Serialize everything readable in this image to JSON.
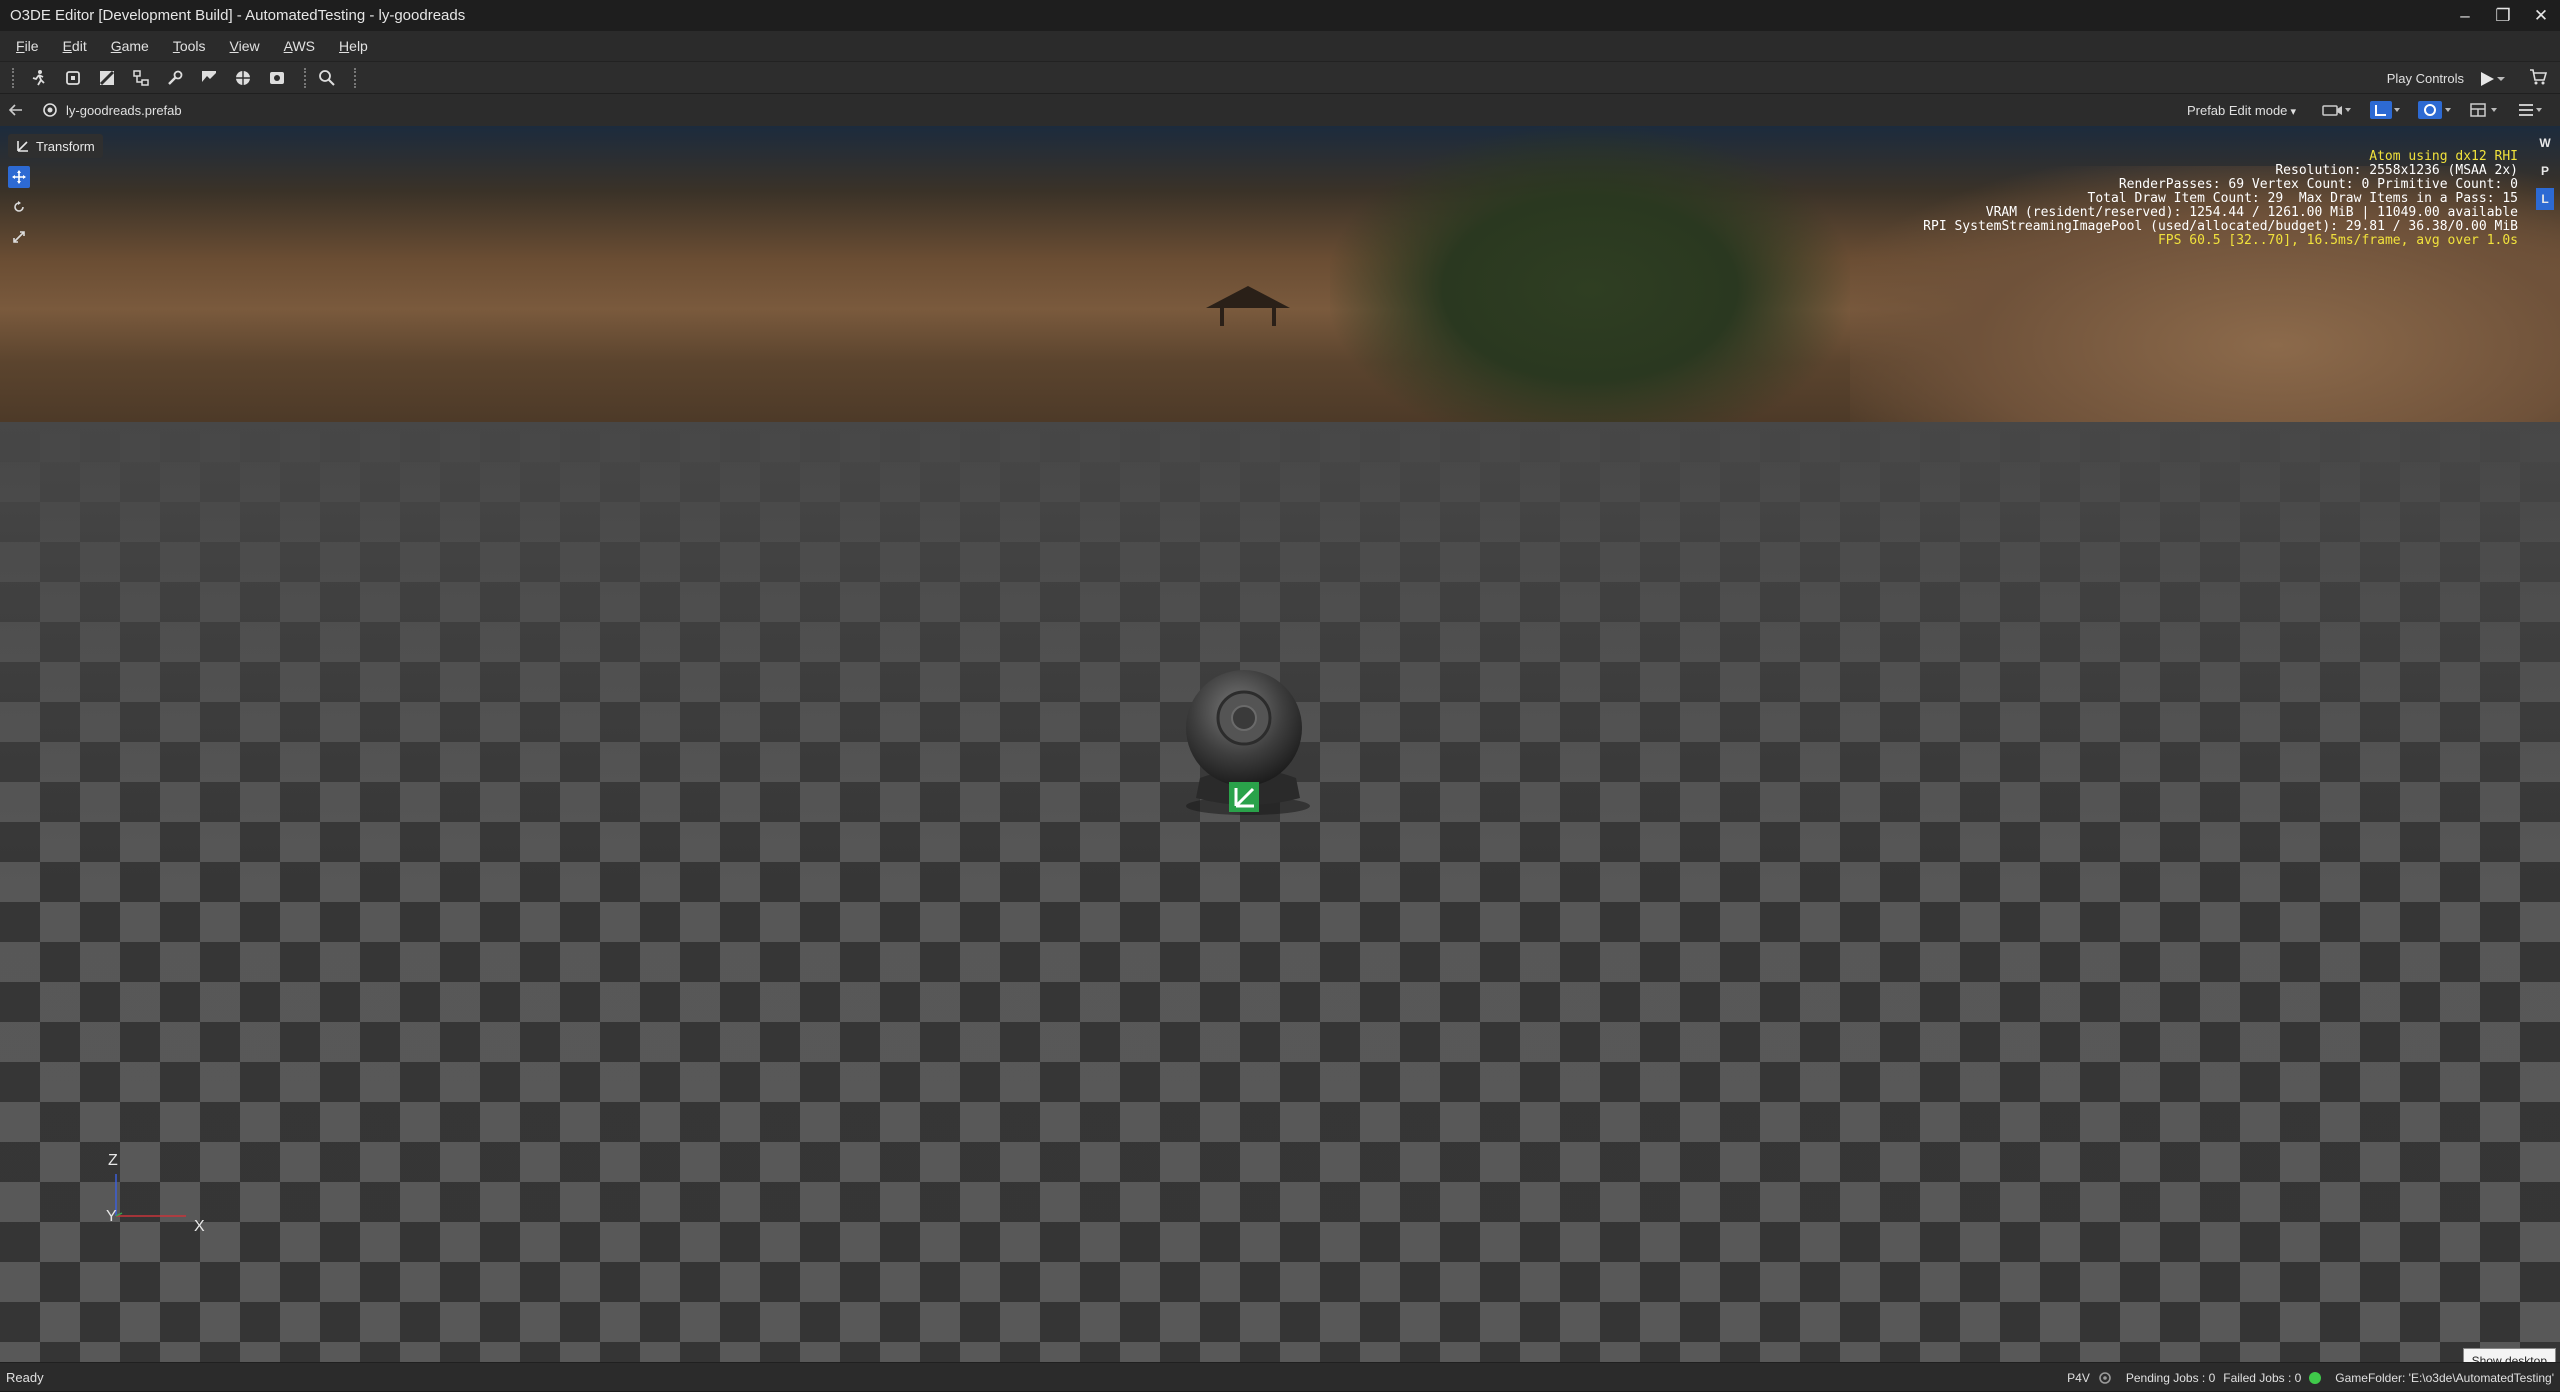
{
  "window": {
    "title": "O3DE Editor [Development Build] - AutomatedTesting - ly-goodreads",
    "minimize_glyph": "–",
    "maximize_glyph": "❐",
    "close_glyph": "✕"
  },
  "menu": [
    "File",
    "Edit",
    "Game",
    "Tools",
    "View",
    "AWS",
    "Help"
  ],
  "toolbar": {
    "icons": [
      "run-icon",
      "component-icon",
      "material-icon",
      "script-canvas-icon",
      "tools-icon",
      "terrain-icon",
      "globe-icon",
      "ui-editor-icon",
      "search-icon"
    ],
    "play_controls_label": "Play Controls"
  },
  "breadcrumb": {
    "prefab": "ly-goodreads.prefab",
    "mode": "Prefab Edit mode"
  },
  "viewport": {
    "transform_label": "Transform",
    "mode_letters": [
      "W",
      "P",
      "L"
    ],
    "active_letter": "L",
    "hud": {
      "line1": "Atom using dx12 RHI",
      "line2": "Resolution: 2558x1236 (MSAA 2x)",
      "line3": "RenderPasses: 69 Vertex Count: 0 Primitive Count: 0",
      "line4": "Total Draw Item Count: 29  Max Draw Items in a Pass: 15",
      "line5": "VRAM (resident/reserved): 1254.44 / 1261.00 MiB | 11049.00 available",
      "line6": "RPI SystemStreamingImagePool (used/allocated/budget): 29.81 / 36.38/0.00 MiB",
      "line7": "FPS 60.5 [32..70], 16.5ms/frame, avg over 1.0s"
    },
    "axis_labels": {
      "z": "Z",
      "y": "Y",
      "x": "X"
    },
    "show_desktop": "Show desktop"
  },
  "status": {
    "ready": "Ready",
    "p4v": "P4V",
    "pending_jobs": "Pending Jobs : 0",
    "failed_jobs": "Failed Jobs : 0",
    "game_folder": "GameFolder: 'E:\\o3de\\AutomatedTesting'"
  },
  "colors": {
    "accent": "#2d6ad3",
    "hud_highlight": "#f1e23c",
    "status_ok": "#3fc94a"
  }
}
